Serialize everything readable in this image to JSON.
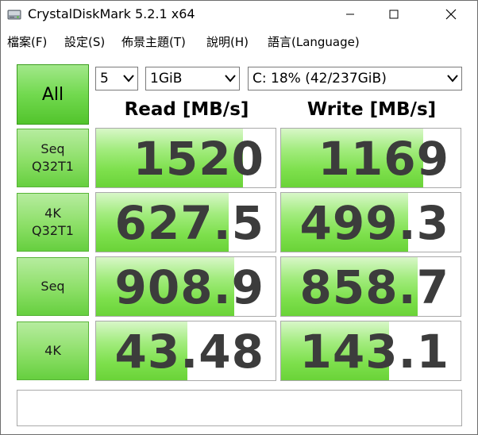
{
  "window": {
    "title": "CrystalDiskMark 5.2.1 x64"
  },
  "menu": [
    {
      "label": "檔案(F)"
    },
    {
      "label": "設定(S)"
    },
    {
      "label": "佈景主題(T)"
    },
    {
      "label": "說明(H)"
    },
    {
      "label": "語言(Language)"
    }
  ],
  "controls": {
    "all_label": "All",
    "count_value": "5",
    "size_value": "1GiB",
    "drive_value": "C: 18% (42/237GiB)"
  },
  "headers": {
    "read": "Read [MB/s]",
    "write": "Write [MB/s]"
  },
  "tests": [
    {
      "label_line1": "Seq",
      "label_line2": "Q32T1",
      "read": "1520",
      "write": "1169",
      "read_fill": 0.82,
      "write_fill": 0.79
    },
    {
      "label_line1": "4K",
      "label_line2": "Q32T1",
      "read": "627.5",
      "write": "499.3",
      "read_fill": 0.74,
      "write_fill": 0.71
    },
    {
      "label_line1": "Seq",
      "label_line2": "",
      "read": "908.9",
      "write": "858.7",
      "read_fill": 0.77,
      "write_fill": 0.76
    },
    {
      "label_line1": "4K",
      "label_line2": "",
      "read": "43.48",
      "write": "143.1",
      "read_fill": 0.51,
      "write_fill": 0.6
    }
  ],
  "comment": "",
  "colors": {
    "accent_green": "#7ee04d",
    "value_text": "#3c3c3c"
  }
}
